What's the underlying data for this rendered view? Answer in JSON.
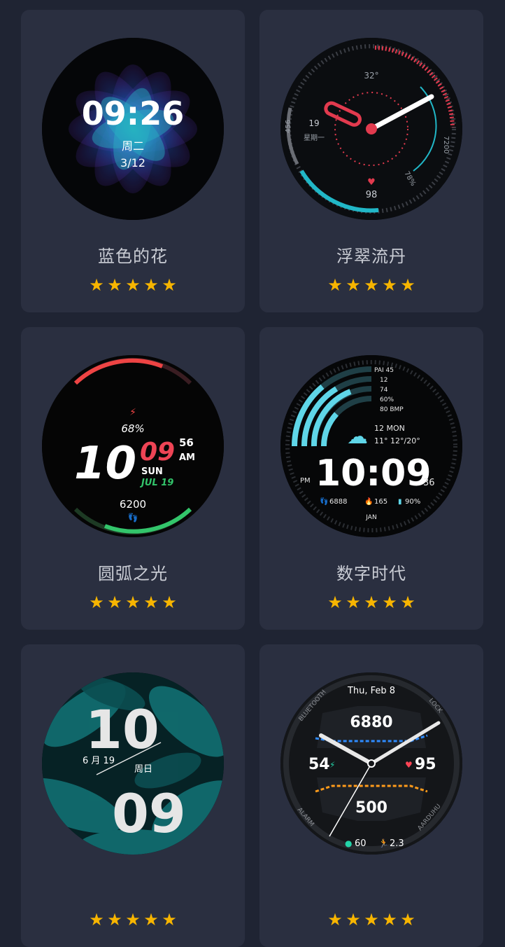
{
  "watch_faces": [
    {
      "name": "蓝色的花",
      "rating": 5,
      "face": {
        "time": "09:26",
        "weekday": "周二",
        "date": "3/12"
      }
    },
    {
      "name": "浮翠流丹",
      "rating": 5,
      "face": {
        "temp": "32°",
        "day": "19",
        "weekday": "星期一",
        "steps": "456",
        "calories": "7200",
        "heart": "98",
        "battery": "78%"
      }
    },
    {
      "name": "圆弧之光",
      "rating": 5,
      "face": {
        "battery": "68%",
        "hour": "10",
        "minute": "09",
        "second": "56",
        "ampm": "AM",
        "weekday": "SUN",
        "date": "JUL 19",
        "steps": "6200"
      }
    },
    {
      "name": "数字时代",
      "rating": 5,
      "face": {
        "stats": [
          "PAI 45",
          "12",
          "74",
          "60%",
          "80 BMP"
        ],
        "date": "12 MON",
        "weather": "11° 12°/20°",
        "time": "10:09",
        "ampm": "PM",
        "seconds": "36",
        "steps": "6888",
        "calories": "165",
        "battery": "90%",
        "month": "JAN"
      }
    },
    {
      "name": "",
      "rating": 5,
      "face": {
        "hour": "10",
        "minute": "09",
        "date": "6 月 19",
        "weekday": "周日"
      }
    },
    {
      "name": "",
      "rating": 5,
      "face": {
        "date": "Thu, Feb 8",
        "steps": "6880",
        "battery": "54",
        "heart": "95",
        "calories": "500",
        "water": "60",
        "distance": "2.3",
        "bluetooth": "BLUETOOTH",
        "lock": "LOCK",
        "alarm": "ALARM",
        "aarduhu": "AARDUHU"
      }
    }
  ],
  "colors": {
    "background": "#1f2433",
    "card": "#2a2f40",
    "star": "#f7b500"
  },
  "star_glyph": "★"
}
